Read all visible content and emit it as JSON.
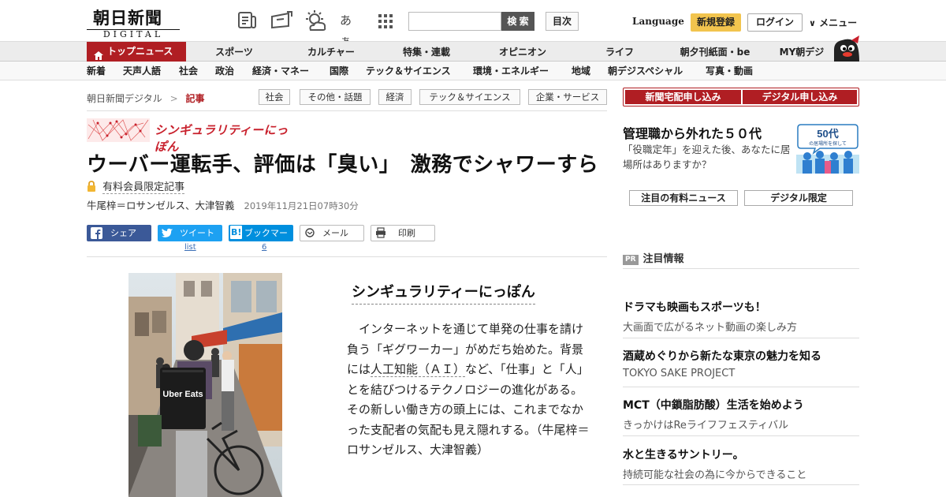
{
  "header": {
    "logo_top": "朝日新聞",
    "logo_bottom": "DIGITAL",
    "icons": [
      "newspaper-icon",
      "scrap-icon",
      "weather-icon",
      "font-size-icon",
      "grid-apps-icon"
    ],
    "font_size_glyph": "あぁ",
    "search": {
      "placeholder": "",
      "button_label": "検 索"
    },
    "toc_label": "目次",
    "language_label": "Language",
    "signup_label": "新規登録",
    "login_label": "ログイン",
    "menu_label": "メニュー",
    "menu_chevron": "∨"
  },
  "nav_primary": {
    "active": "トップニュース",
    "items": [
      "スポーツ",
      "カルチャー",
      "特集・連載",
      "オピニオン",
      "ライフ",
      "朝夕刊紙面・be",
      "MY朝デジ"
    ]
  },
  "nav_secondary": {
    "items": [
      "新着",
      "天声人語",
      "社会",
      "政治",
      "経済・マネー",
      "国際",
      "テック＆サイエンス",
      "環境・エネルギー",
      "地域",
      "朝デジスペシャル",
      "写真・動画"
    ]
  },
  "breadcrumb": {
    "home": "朝日新聞デジタル",
    "separator": ">",
    "current": "記事"
  },
  "article_tags": [
    "社会",
    "その他・話題",
    "経済",
    "テック＆サイエンス",
    "企業・サービス"
  ],
  "article": {
    "series_banner": "シンギュラリティーにっぽん",
    "headline": "ウーバー運転手、評価は「臭い」　激務でシャワーすら",
    "paid_label": "有料会員限定記事",
    "byline": "牛尾梓＝ロサンゼルス、大津智義",
    "date": "2019年11月21日07時30分",
    "share": {
      "facebook": "シェア",
      "twitter": "ツイート",
      "twitter_count": "list",
      "hatena": "ブックマーク",
      "hatena_icon": "B!",
      "hatena_count": "6",
      "mail": "メール",
      "print": "印刷"
    },
    "intro_title": "シンギュラリティーにっぽん",
    "intro_p1": "インターネットを通じて単発の仕事を請け負う「ギグワーカー」がめだち始めた。背景には",
    "intro_ai": "人工知能（ＡＩ）",
    "intro_p2": "など、「仕事」と「人」とを結びつけるテクノロジーの進化がある。その新しい働き方の頭上には、これまでなかった支配者の気配も見え隠れする。（牛尾梓＝ロサンゼルス、大津智義）",
    "photo_bag_text": "Uber Eats"
  },
  "sidebar": {
    "subscribe_paper": "新聞宅配申し込み",
    "subscribe_digital": "デジタル申し込み",
    "promo": {
      "title": "管理職から外れた５０代",
      "body": "「役職定年」を迎えた後、あなたに居場所はありますか？",
      "image_text": "50代",
      "image_sub": "の居場所を探して"
    },
    "tab_paid_news": "注目の有料ニュース",
    "tab_digital_only": "デジタル限定",
    "pr_badge": "PR",
    "pr_heading": "注目情報",
    "pr_items": [
      {
        "title": "ドラマも映画もスポーツも！",
        "sub": "大画面で広がるネット動画の楽しみ方"
      },
      {
        "title": "酒蔵めぐりから新たな東京の魅力を知る",
        "sub": "TOKYO SAKE PROJECT"
      },
      {
        "title": "MCT（中鎖脂肪酸）生活を始めよう",
        "sub": "きっかけはReライフフェスティバル"
      },
      {
        "title": "水と生きるサントリー。",
        "sub": "持続可能な社会の為に今からできること"
      }
    ]
  },
  "colors": {
    "brand_red": "#b01e23",
    "signup_yellow": "#f2c44e",
    "facebook": "#3b5998",
    "twitter": "#1da1f2",
    "hatena": "#008fde"
  }
}
